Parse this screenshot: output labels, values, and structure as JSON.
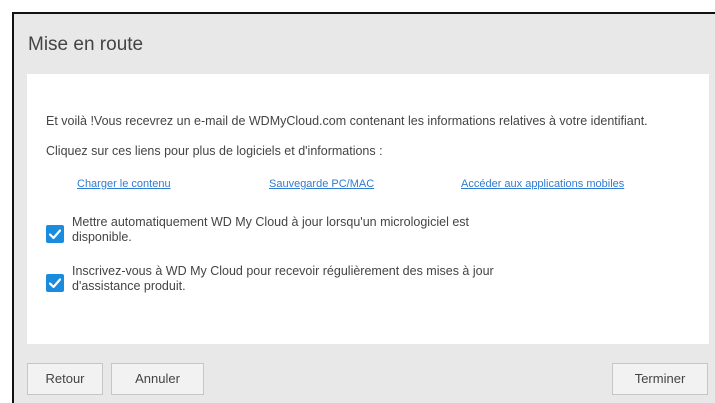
{
  "dialog": {
    "title": "Mise en route",
    "message": "Et voilà !Vous recevrez un e-mail de WDMyCloud.com contenant les informations relatives à votre identifiant.",
    "links_intro": "Cliquez sur ces liens pour plus de logiciels et d'informations :",
    "links": [
      {
        "label": "Charger le contenu"
      },
      {
        "label": "Sauvegarde PC/MAC"
      },
      {
        "label": "Accéder aux applications mobiles"
      }
    ],
    "options": [
      {
        "label": "Mettre automatiquement WD My Cloud à jour lorsqu'un micrologiciel est disponible.",
        "checked": true
      },
      {
        "label": "Inscrivez-vous à WD My Cloud pour recevoir régulièrement des mises à jour d'assistance produit.",
        "checked": true
      }
    ]
  },
  "footer": {
    "back_label": "Retour",
    "cancel_label": "Annuler",
    "finish_label": "Terminer"
  },
  "colors": {
    "accent": "#1a8ce0",
    "link": "#2f7cd1",
    "background": "#e8e8e8",
    "panel": "#ffffff"
  },
  "icons": {
    "checkbox": "check-icon"
  }
}
